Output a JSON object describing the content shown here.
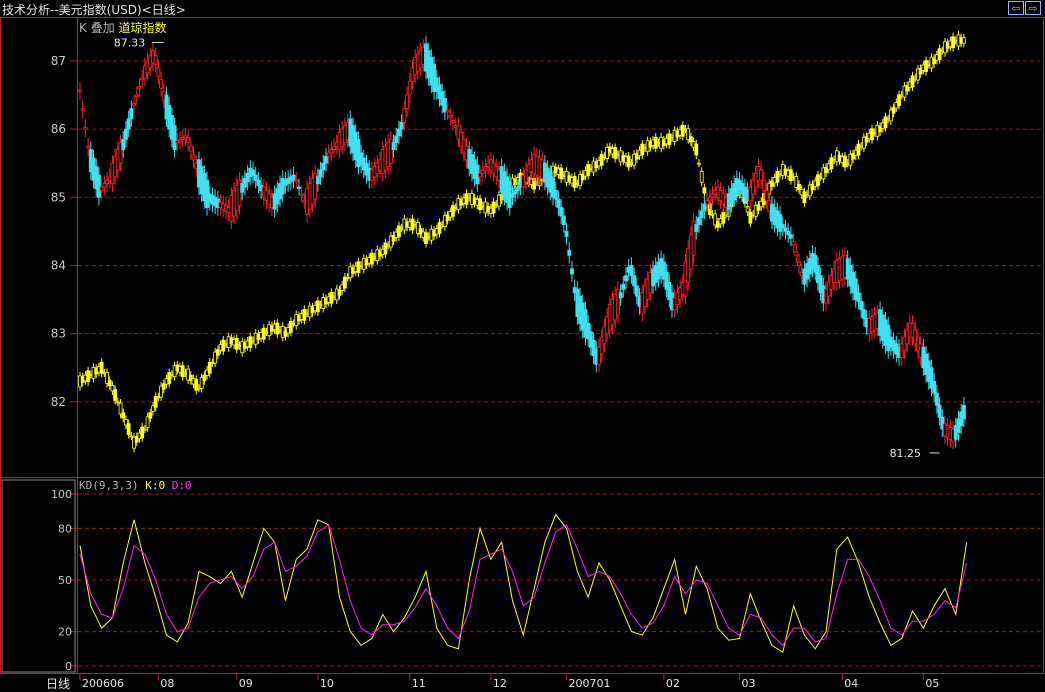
{
  "window": {
    "title": "技术分析--美元指数(USD)<日线>",
    "nav_prev_icon": "arrow-left-icon",
    "nav_next_icon": "arrow-right-icon"
  },
  "kline_panel": {
    "label_k": "K",
    "label_overlay": "叠加",
    "overlay_name": "道琼指数",
    "max_label": "87.33",
    "min_label": "81.25",
    "y_ticks": [
      "87",
      "86",
      "85",
      "84",
      "83",
      "82"
    ],
    "colors": {
      "up": "#ff2020",
      "down": "#40e0f0",
      "overlay": "#ffff20",
      "grid": "#a01818"
    }
  },
  "kd_panel": {
    "label_params": "KD(9,3,3)",
    "label_k": "K:0",
    "label_d": "D:0",
    "y_ticks": [
      "100",
      "80",
      "50",
      "20",
      "0"
    ],
    "colors": {
      "k": "#ffff20",
      "d": "#ff20ff"
    }
  },
  "x_axis": {
    "period_label": "日线",
    "month_labels": [
      "200606",
      "08",
      "09",
      "10",
      "11",
      "12",
      "200701",
      "02",
      "03",
      "04",
      "05"
    ]
  },
  "chart_data": {
    "type": "line",
    "series": [
      {
        "name": "美元指数",
        "x": [
          0,
          4,
          8,
          12,
          16,
          20,
          24,
          28,
          32,
          36,
          40,
          44,
          48,
          52,
          56,
          60,
          64,
          68,
          72,
          76,
          80,
          84,
          88,
          92,
          96,
          100,
          104,
          108,
          112,
          116,
          120,
          124,
          128,
          132,
          136,
          140,
          144,
          148,
          152,
          156,
          160,
          164,
          168,
          172,
          176,
          180,
          184,
          188,
          192,
          196,
          200,
          204,
          208,
          212,
          216,
          220,
          224,
          228,
          232,
          236,
          240,
          244,
          248,
          252,
          256,
          260,
          264,
          268,
          272,
          276,
          280,
          284,
          288,
          292,
          296,
          300,
          304,
          308,
          312,
          316,
          320,
          324,
          328
        ],
        "values": [
          86.7,
          85.6,
          85.1,
          85.3,
          85.7,
          86.3,
          86.8,
          87.1,
          86.4,
          85.8,
          85.9,
          85.4,
          85.0,
          84.9,
          84.8,
          85.1,
          85.4,
          85.1,
          84.9,
          85.2,
          85.3,
          84.9,
          85.2,
          85.6,
          85.8,
          86.0,
          85.6,
          85.3,
          85.5,
          85.7,
          86.1,
          86.9,
          87.1,
          86.7,
          86.3,
          86.0,
          85.6,
          85.3,
          85.5,
          85.3,
          85.0,
          85.2,
          85.5,
          85.4,
          85.1,
          84.6,
          83.5,
          83.1,
          82.6,
          83.2,
          83.5,
          84.0,
          83.4,
          83.8,
          84.0,
          83.4,
          83.7,
          84.5,
          84.9,
          85.1,
          84.9,
          85.2,
          85.0,
          85.4,
          84.8,
          84.6,
          84.4,
          83.8,
          84.1,
          83.5,
          83.9,
          84.0,
          83.6,
          83.1,
          83.2,
          82.9,
          82.7,
          83.1,
          82.7,
          82.3,
          81.6,
          81.5,
          81.9
        ]
      },
      {
        "name": "道琼指数",
        "x": [
          0,
          4,
          8,
          12,
          16,
          20,
          24,
          28,
          32,
          36,
          40,
          44,
          48,
          52,
          56,
          60,
          64,
          68,
          72,
          76,
          80,
          84,
          88,
          92,
          96,
          100,
          104,
          108,
          112,
          116,
          120,
          124,
          128,
          132,
          136,
          140,
          144,
          148,
          152,
          156,
          160,
          164,
          168,
          172,
          176,
          180,
          184,
          188,
          192,
          196,
          200,
          204,
          208,
          212,
          216,
          220,
          224,
          228,
          232,
          236,
          240,
          244,
          248,
          252,
          256,
          260,
          264,
          268,
          272,
          276,
          280,
          284,
          288,
          292,
          296,
          300,
          304,
          308,
          312,
          316,
          320,
          324,
          328
        ],
        "values": [
          82.3,
          82.4,
          82.5,
          82.2,
          81.8,
          81.4,
          81.6,
          82.0,
          82.3,
          82.5,
          82.4,
          82.2,
          82.5,
          82.8,
          82.9,
          82.8,
          82.9,
          83.0,
          83.1,
          83.0,
          83.2,
          83.3,
          83.4,
          83.5,
          83.6,
          83.9,
          84.0,
          84.1,
          84.2,
          84.4,
          84.6,
          84.6,
          84.4,
          84.5,
          84.7,
          84.9,
          85.0,
          84.9,
          84.8,
          85.0,
          85.2,
          85.3,
          85.2,
          85.3,
          85.4,
          85.3,
          85.2,
          85.4,
          85.5,
          85.7,
          85.6,
          85.5,
          85.7,
          85.8,
          85.8,
          85.9,
          86.0,
          85.7,
          84.9,
          84.6,
          84.8,
          85.2,
          84.7,
          84.9,
          85.2,
          85.4,
          85.3,
          85.0,
          85.2,
          85.4,
          85.6,
          85.5,
          85.7,
          85.9,
          86.0,
          86.2,
          86.5,
          86.7,
          86.9,
          87.0,
          87.2,
          87.3,
          87.3
        ]
      }
    ],
    "kd": {
      "x": [
        0,
        4,
        8,
        12,
        16,
        20,
        24,
        28,
        32,
        36,
        40,
        44,
        48,
        52,
        56,
        60,
        64,
        68,
        72,
        76,
        80,
        84,
        88,
        92,
        96,
        100,
        104,
        108,
        112,
        116,
        120,
        124,
        128,
        132,
        136,
        140,
        144,
        148,
        152,
        156,
        160,
        164,
        168,
        172,
        176,
        180,
        184,
        188,
        192,
        196,
        200,
        204,
        208,
        212,
        216,
        220,
        224,
        228,
        232,
        236,
        240,
        244,
        248,
        252,
        256,
        260,
        264,
        268,
        272,
        276,
        280,
        284,
        288,
        292,
        296,
        300,
        304,
        308,
        312,
        316,
        320,
        324,
        328
      ],
      "k": [
        70,
        35,
        22,
        28,
        60,
        85,
        60,
        40,
        18,
        14,
        25,
        55,
        52,
        48,
        55,
        40,
        60,
        80,
        72,
        38,
        62,
        68,
        85,
        82,
        40,
        20,
        12,
        16,
        30,
        20,
        28,
        40,
        55,
        22,
        12,
        10,
        50,
        80,
        62,
        72,
        38,
        18,
        45,
        72,
        88,
        80,
        55,
        40,
        60,
        50,
        35,
        20,
        18,
        28,
        45,
        62,
        30,
        58,
        45,
        22,
        15,
        16,
        42,
        26,
        12,
        8,
        35,
        18,
        10,
        20,
        68,
        75,
        60,
        40,
        25,
        12,
        16,
        32,
        22,
        35,
        45,
        30,
        72
      ],
      "d": [
        65,
        42,
        30,
        28,
        45,
        70,
        65,
        50,
        30,
        20,
        22,
        40,
        48,
        50,
        52,
        45,
        52,
        68,
        72,
        55,
        58,
        64,
        78,
        82,
        62,
        38,
        22,
        18,
        24,
        24,
        26,
        34,
        45,
        35,
        22,
        16,
        32,
        62,
        65,
        68,
        55,
        35,
        40,
        60,
        78,
        82,
        68,
        52,
        55,
        52,
        42,
        30,
        22,
        25,
        35,
        52,
        42,
        50,
        48,
        35,
        22,
        18,
        30,
        28,
        18,
        12,
        22,
        22,
        14,
        16,
        42,
        62,
        62,
        52,
        38,
        22,
        18,
        26,
        26,
        30,
        38,
        34,
        60
      ]
    },
    "y_ticks_price": [
      82,
      83,
      84,
      85,
      86,
      87
    ],
    "ylim_price": [
      81.0,
      87.6
    ],
    "ylim_kd": [
      0,
      100
    ],
    "x_labels": [
      "200606",
      "08",
      "09",
      "10",
      "11",
      "12",
      "200701",
      "02",
      "03",
      "04",
      "05"
    ],
    "max_value": 87.33,
    "min_value": 81.25,
    "grid": true
  }
}
